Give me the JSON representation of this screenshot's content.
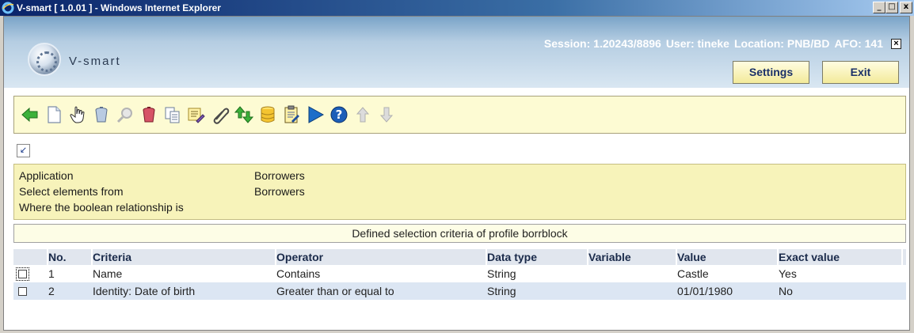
{
  "window": {
    "title": "V-smart [ 1.0.01 ] - Windows Internet Explorer",
    "min_glyph": "_",
    "max_glyph": "□",
    "close_glyph": "x"
  },
  "header": {
    "brand": "V-smart",
    "session": "Session: 1.20243/8896",
    "user": "User: tineke",
    "location": "Location: PNB/BD",
    "afo": "AFO: 141",
    "close_glyph": "×",
    "settings_label": "Settings",
    "exit_label": "Exit"
  },
  "toolbar": {
    "icons": [
      "back-arrow-icon",
      "new-document-icon",
      "hand-select-icon",
      "trash-icon",
      "search-disabled-icon",
      "delete-all-icon",
      "copy-icon",
      "edit-properties-icon",
      "paperclip-icon",
      "sort-arrows-icon",
      "database-icon",
      "clipboard-icon",
      "play-icon",
      "help-icon",
      "up-arrow-icon",
      "down-arrow-icon"
    ]
  },
  "toggle_glyph": "↙",
  "info": {
    "rows": [
      {
        "label": "Application",
        "value": "Borrowers"
      },
      {
        "label": "Select elements from",
        "value": "Borrowers"
      },
      {
        "label": "Where the boolean relationship is",
        "value": ""
      }
    ]
  },
  "section_title": "Defined selection criteria of profile borrblock",
  "table": {
    "headers": [
      "No.",
      "Criteria",
      "Operator",
      "Data type",
      "Variable",
      "Value",
      "Exact value"
    ],
    "rows": [
      {
        "no": "1",
        "criteria": "Name",
        "operator": "Contains",
        "data_type": "String",
        "variable": "",
        "value": "Castle",
        "exact": "Yes"
      },
      {
        "no": "2",
        "criteria": "Identity: Date of birth",
        "operator": "Greater than or equal to",
        "data_type": "String",
        "variable": "",
        "value": "01/01/1980",
        "exact": "No"
      }
    ]
  },
  "colors": {
    "toolbar_bg": "#fdfbd3",
    "info_bg": "#f7f3ba",
    "header_text": "#ffffff",
    "button_text": "#1a3068",
    "alt_row": "#dce6f3"
  }
}
